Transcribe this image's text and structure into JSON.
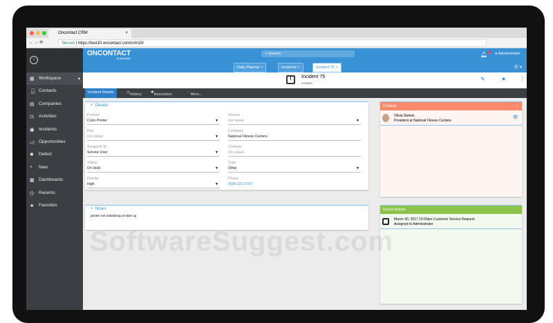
{
  "browser": {
    "tab_title": "Oncontact CRM",
    "secure": "Secure",
    "url": "https://test10.oncontact.com/crm10/"
  },
  "app": {
    "logo": "ONCONTACT",
    "logo_sub": "by WorkWise",
    "search_placeholder": "Search",
    "user": "Administrator",
    "notif_count": "1",
    "tabs": [
      {
        "label": "Daily Planner"
      },
      {
        "label": "Incidents"
      },
      {
        "label": "Incident 75"
      }
    ]
  },
  "sidebar": {
    "items": [
      {
        "label": "Workspace",
        "icon": "workspace-icon"
      },
      {
        "label": "Contacts",
        "icon": "person-icon"
      },
      {
        "label": "Companies",
        "icon": "building-icon"
      },
      {
        "label": "Activities",
        "icon": "clock-icon"
      },
      {
        "label": "Incidents",
        "icon": "incident-icon"
      },
      {
        "label": "Opportunities",
        "icon": "thumbs-up-icon"
      },
      {
        "label": "Defect",
        "icon": "bug-icon"
      },
      {
        "label": "New",
        "icon": "plus-icon"
      },
      {
        "label": "Dashboards",
        "icon": "dashboard-icon"
      },
      {
        "label": "Recents",
        "icon": "history-icon"
      },
      {
        "label": "Favorites",
        "icon": "star-icon"
      }
    ]
  },
  "record": {
    "title": "Incident 75",
    "subtitle": "Incident"
  },
  "subtabs": [
    "Incident Details",
    "History",
    "Resolution",
    "More..."
  ],
  "details": {
    "title": "Details",
    "fields": [
      {
        "label": "Product",
        "value": "Color Printer",
        "dropdown": true
      },
      {
        "label": "Version",
        "value": "(no value)",
        "dropdown": true
      },
      {
        "label": "Part",
        "value": "(no value)",
        "dropdown": true
      },
      {
        "label": "Company",
        "value": "National Fitness Centers"
      },
      {
        "label": "Assigned To",
        "value": "Service User",
        "dropdown": true
      },
      {
        "label": "Contract",
        "value": "(no value)"
      },
      {
        "label": "Status",
        "value": "On Hold",
        "dropdown": true
      },
      {
        "label": "Type",
        "value": "Other",
        "dropdown": true
      },
      {
        "label": "Priority",
        "value": "High",
        "dropdown": true
      },
      {
        "label": "Phone",
        "value": "(505) 321-6767"
      }
    ]
  },
  "notes": {
    "title": "Notes",
    "text": "printer not initializing at start up"
  },
  "contacts": {
    "title": "Contacts",
    "color": "#f98b6c",
    "name": "Olivia Stefani",
    "role": "President at National Fitness Centers"
  },
  "activity": {
    "title": "Recent Activity",
    "color": "#8bc34a",
    "line1": "March 30, 2017 10:50am Customer Service Request",
    "line2": "Assigned to Administrator"
  },
  "watermark": "SoftwareSuggest.com"
}
